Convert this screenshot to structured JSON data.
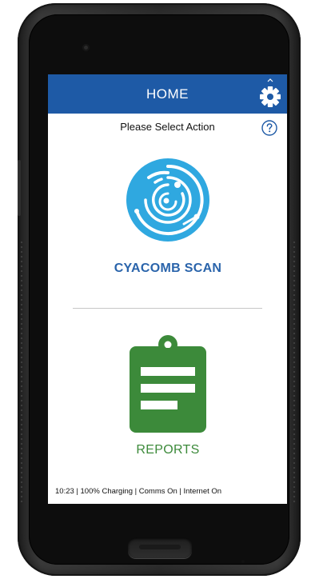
{
  "header": {
    "title": "HOME",
    "settings_icon": "gear-icon",
    "color": "#1e5aa6"
  },
  "prompt": {
    "text": "Please Select Action",
    "help_icon": "question-circle-icon"
  },
  "actions": [
    {
      "label": "CYACOMB SCAN",
      "icon": "cyacomb-logo-icon",
      "color": "#2a64ab",
      "icon_color": "#2fa8e0"
    },
    {
      "label": "REPORTS",
      "icon": "clipboard-report-icon",
      "color": "#3c8a3a"
    }
  ],
  "status_bar": {
    "text": "10:23  | 100%  Charging | Comms On | Internet On"
  }
}
